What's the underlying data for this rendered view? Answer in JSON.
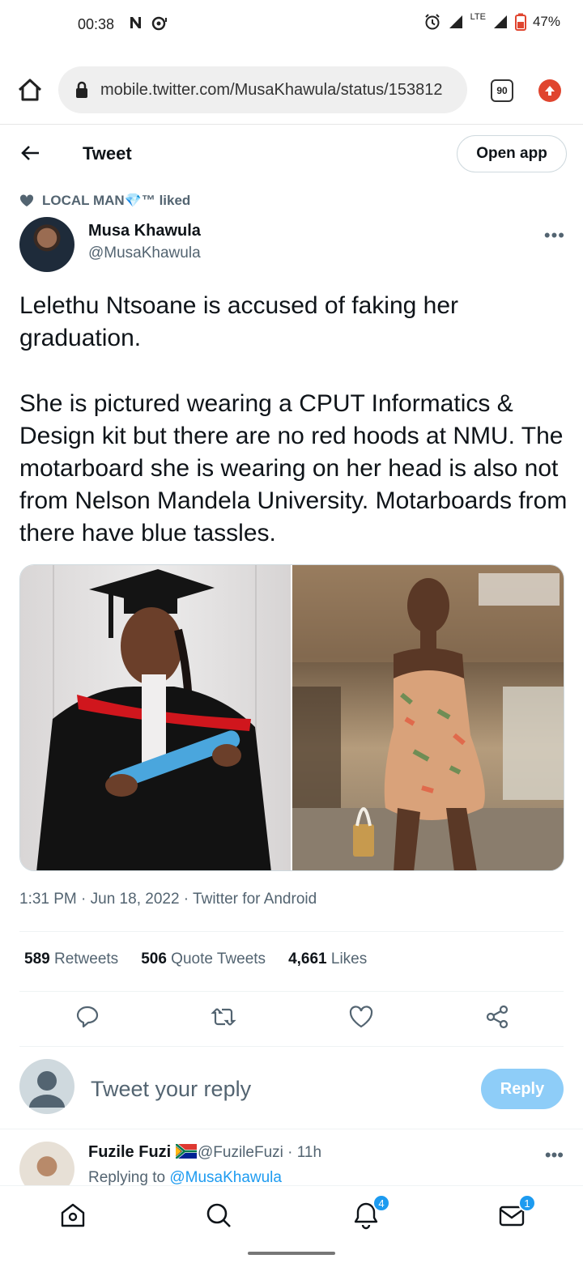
{
  "statusbar": {
    "time": "00:38",
    "network": "LTE",
    "battery": "47%"
  },
  "browser": {
    "url": "mobile.twitter.com/MusaKhawula/status/153812",
    "tab_count": "90"
  },
  "header": {
    "title": "Tweet",
    "open_app": "Open app"
  },
  "social_context": {
    "text": "LOCAL MAN💎™ liked"
  },
  "tweet": {
    "author_name": "Musa Khawula",
    "author_handle": "@MusaKhawula",
    "more": "•••",
    "text": "Lelethu Ntsoane is accused of faking her graduation.\n\nShe is pictured wearing a CPUT Informatics & Design kit but there are no red hoods at NMU. The motarboard she is wearing on her head is also not from Nelson Mandela University. Motarboards from there have blue tassles.",
    "meta": "1:31 PM · Jun 18, 2022 · Twitter for Android",
    "stats": {
      "retweets_count": "589",
      "retweets_label": "Retweets",
      "quotes_count": "506",
      "quotes_label": "Quote Tweets",
      "likes_count": "4,661",
      "likes_label": "Likes"
    }
  },
  "reply_composer": {
    "placeholder": "Tweet your reply",
    "button": "Reply"
  },
  "reply": {
    "name": "Fuzile Fuzi",
    "handle_time": "@FuzileFuzi · 11h",
    "replying_prefix": "Replying to ",
    "replying_to": "@MusaKhawula",
    "more": "•••"
  },
  "bottom_nav": {
    "notifications_badge": "4",
    "messages_badge": "1"
  },
  "colors": {
    "twitter_blue": "#1d9bf0",
    "reply_button": "#8ecdf8",
    "update_red": "#e0452f"
  }
}
